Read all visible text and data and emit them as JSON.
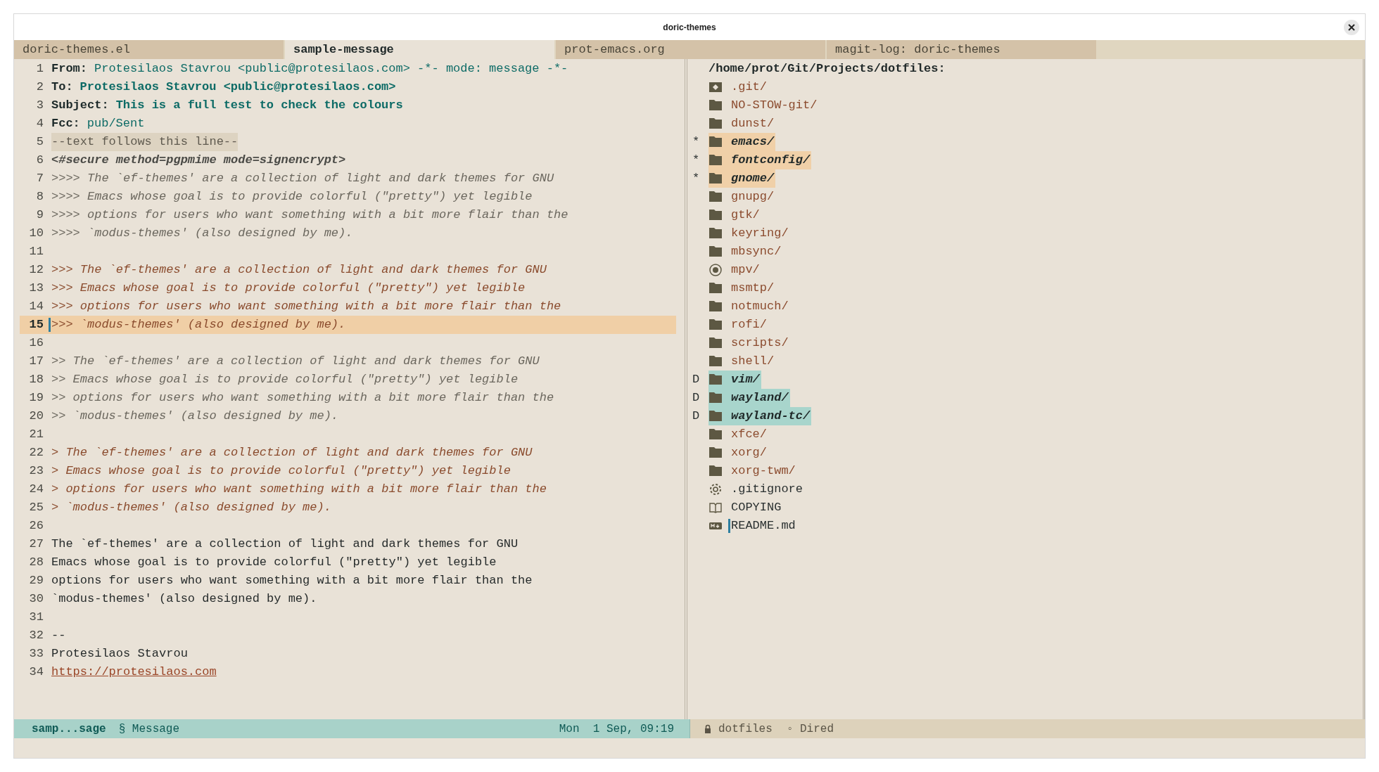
{
  "window": {
    "title": "doric-themes"
  },
  "tabs": [
    {
      "label": "doric-themes.el",
      "selected": false
    },
    {
      "label": "sample-message",
      "selected": true
    },
    {
      "label": "prot-emacs.org",
      "selected": false
    },
    {
      "label": "magit-log: doric-themes",
      "selected": false
    }
  ],
  "message": {
    "lines": [
      {
        "number": "1",
        "kind": "header",
        "label": "From:",
        "value": "Protesilaos Stavrou <public@protesilaos.com> -*- mode: message -*-",
        "bold": false,
        "current": false
      },
      {
        "number": "2",
        "kind": "header",
        "label": "To:",
        "value": "Protesilaos Stavrou <public@protesilaos.com>",
        "bold": true,
        "current": false
      },
      {
        "number": "3",
        "kind": "header",
        "label": "Subject:",
        "value": "This is a full test to check the colours",
        "bold": true,
        "current": false
      },
      {
        "number": "4",
        "kind": "header",
        "label": "Fcc:",
        "value": "pub/Sent",
        "bold": false,
        "current": false
      },
      {
        "number": "5",
        "kind": "separator",
        "text": "--text follows this line--",
        "current": false
      },
      {
        "number": "6",
        "kind": "secure",
        "text": "<#secure method=pgpmime mode=signencrypt>",
        "current": false
      },
      {
        "number": "7",
        "kind": "quote4",
        "text": ">>>> The `ef-themes' are a collection of light and dark themes for GNU",
        "current": false
      },
      {
        "number": "8",
        "kind": "quote4",
        "text": ">>>> Emacs whose goal is to provide colorful (\"pretty\") yet legible",
        "current": false
      },
      {
        "number": "9",
        "kind": "quote4",
        "text": ">>>> options for users who want something with a bit more flair than the",
        "current": false
      },
      {
        "number": "10",
        "kind": "quote4",
        "text": ">>>> `modus-themes' (also designed by me).",
        "current": false
      },
      {
        "number": "11",
        "kind": "blank",
        "current": false
      },
      {
        "number": "12",
        "kind": "quote3",
        "text": ">>> The `ef-themes' are a collection of light and dark themes for GNU",
        "current": false
      },
      {
        "number": "13",
        "kind": "quote3",
        "text": ">>> Emacs whose goal is to provide colorful (\"pretty\") yet legible",
        "current": false
      },
      {
        "number": "14",
        "kind": "quote3",
        "text": ">>> options for users who want something with a bit more flair than the",
        "current": false
      },
      {
        "number": "15",
        "kind": "quote3",
        "text": ">>> `modus-themes' (also designed by me).",
        "current": true
      },
      {
        "number": "16",
        "kind": "blank",
        "current": false
      },
      {
        "number": "17",
        "kind": "quote2",
        "text": ">> The `ef-themes' are a collection of light and dark themes for GNU",
        "current": false
      },
      {
        "number": "18",
        "kind": "quote2",
        "text": ">> Emacs whose goal is to provide colorful (\"pretty\") yet legible",
        "current": false
      },
      {
        "number": "19",
        "kind": "quote2",
        "text": ">> options for users who want something with a bit more flair than the",
        "current": false
      },
      {
        "number": "20",
        "kind": "quote2",
        "text": ">> `modus-themes' (also designed by me).",
        "current": false
      },
      {
        "number": "21",
        "kind": "blank",
        "current": false
      },
      {
        "number": "22",
        "kind": "quote1",
        "text": "> The `ef-themes' are a collection of light and dark themes for GNU",
        "current": false
      },
      {
        "number": "23",
        "kind": "quote1",
        "text": "> Emacs whose goal is to provide colorful (\"pretty\") yet legible",
        "current": false
      },
      {
        "number": "24",
        "kind": "quote1",
        "text": "> options for users who want something with a bit more flair than the",
        "current": false
      },
      {
        "number": "25",
        "kind": "quote1",
        "text": "> `modus-themes' (also designed by me).",
        "current": false
      },
      {
        "number": "26",
        "kind": "blank",
        "current": false
      },
      {
        "number": "27",
        "kind": "body",
        "text": "The `ef-themes' are a collection of light and dark themes for GNU",
        "current": false
      },
      {
        "number": "28",
        "kind": "body",
        "text": "Emacs whose goal is to provide colorful (\"pretty\") yet legible",
        "current": false
      },
      {
        "number": "29",
        "kind": "body",
        "text": "options for users who want something with a bit more flair than the",
        "current": false
      },
      {
        "number": "30",
        "kind": "body",
        "text": "`modus-themes' (also designed by me).",
        "current": false
      },
      {
        "number": "31",
        "kind": "blank",
        "current": false
      },
      {
        "number": "32",
        "kind": "body",
        "text": "--",
        "current": false
      },
      {
        "number": "33",
        "kind": "body",
        "text": "Protesilaos Stavrou",
        "current": false
      },
      {
        "number": "34",
        "kind": "link",
        "text": "https://protesilaos.com",
        "current": false
      }
    ]
  },
  "dired": {
    "path": "/home/prot/Git/Projects/dotfiles:",
    "entries": [
      {
        "name": ".git/",
        "kind": "repo",
        "marked": false,
        "deletion": false,
        "current": false
      },
      {
        "name": "NO-STOW-git/",
        "kind": "dir",
        "marked": false,
        "deletion": false,
        "current": false
      },
      {
        "name": "dunst/",
        "kind": "dir",
        "marked": false,
        "deletion": false,
        "current": false
      },
      {
        "flag": "*",
        "name": "emacs/",
        "kind": "dir",
        "marked": true,
        "deletion": false,
        "current": false
      },
      {
        "flag": "*",
        "name": "fontconfig/",
        "kind": "dir",
        "marked": true,
        "deletion": false,
        "current": false
      },
      {
        "flag": "*",
        "name": "gnome/",
        "kind": "dir",
        "marked": true,
        "deletion": false,
        "current": false
      },
      {
        "name": "gnupg/",
        "kind": "dir",
        "marked": false,
        "deletion": false,
        "current": false
      },
      {
        "name": "gtk/",
        "kind": "dir",
        "marked": false,
        "deletion": false,
        "current": false
      },
      {
        "name": "keyring/",
        "kind": "dir",
        "marked": false,
        "deletion": false,
        "current": false
      },
      {
        "name": "mbsync/",
        "kind": "dir",
        "marked": false,
        "deletion": false,
        "current": false
      },
      {
        "name": "mpv/",
        "kind": "media",
        "marked": false,
        "deletion": false,
        "current": false
      },
      {
        "name": "msmtp/",
        "kind": "dir",
        "marked": false,
        "deletion": false,
        "current": false
      },
      {
        "name": "notmuch/",
        "kind": "dir",
        "marked": false,
        "deletion": false,
        "current": false
      },
      {
        "name": "rofi/",
        "kind": "dir",
        "marked": false,
        "deletion": false,
        "current": false
      },
      {
        "name": "scripts/",
        "kind": "dir",
        "marked": false,
        "deletion": false,
        "current": false
      },
      {
        "name": "shell/",
        "kind": "dir",
        "marked": false,
        "deletion": false,
        "current": false
      },
      {
        "flag": "D",
        "name": "vim/",
        "kind": "dir",
        "marked": false,
        "deletion": true,
        "current": false
      },
      {
        "flag": "D",
        "name": "wayland/",
        "kind": "dir",
        "marked": false,
        "deletion": true,
        "current": false
      },
      {
        "flag": "D",
        "name": "wayland-tc/",
        "kind": "dir",
        "marked": false,
        "deletion": true,
        "current": false
      },
      {
        "name": "xfce/",
        "kind": "dir",
        "marked": false,
        "deletion": false,
        "current": false
      },
      {
        "name": "xorg/",
        "kind": "dir",
        "marked": false,
        "deletion": false,
        "current": false
      },
      {
        "name": "xorg-twm/",
        "kind": "dir",
        "marked": false,
        "deletion": false,
        "current": false
      },
      {
        "name": ".gitignore",
        "kind": "config",
        "marked": false,
        "deletion": false,
        "current": false
      },
      {
        "name": "COPYING",
        "kind": "document",
        "marked": false,
        "deletion": false,
        "current": false
      },
      {
        "name": "README.md",
        "kind": "markdown",
        "marked": false,
        "deletion": false,
        "current": true
      }
    ]
  },
  "mode_lines": [
    {
      "active": true,
      "buffer": "samp...sage",
      "mode": "§ Message",
      "time": "Mon  1 Sep, 09:19"
    },
    {
      "active": false,
      "locked": true,
      "buffer": "dotfiles",
      "mode": "◦ Dired"
    }
  ]
}
